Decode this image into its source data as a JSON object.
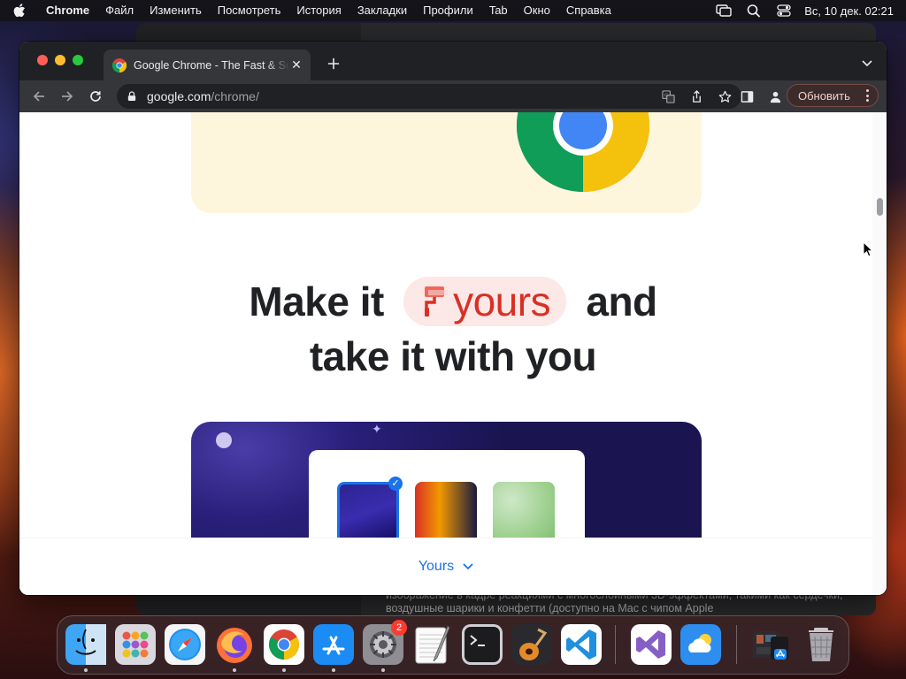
{
  "menubar": {
    "app_name": "Chrome",
    "items": [
      "Файл",
      "Изменить",
      "Посмотреть",
      "История",
      "Закладки",
      "Профили",
      "Tab",
      "Окно",
      "Справка"
    ],
    "clock": "Вс, 10 дек.  02:21"
  },
  "background_window": {
    "text": "изображение в кадре реакциями с многослойными 3D-эффектами, такими как сердечки, воздушные шарики и конфетти (доступно на Mac с чипом Apple"
  },
  "browser": {
    "tab_title": "Google Chrome - The Fast & Secure",
    "url_host": "google.com",
    "url_path": "/chrome/",
    "update_button": "Обновить"
  },
  "page": {
    "headline_before": "Make it",
    "headline_pill": "yours",
    "headline_after": "and",
    "headline_line2": "take it with you",
    "bottom_nav_label": "Yours"
  },
  "dock": {
    "items": [
      {
        "name": "finder-icon",
        "running": true
      },
      {
        "name": "launchpad-icon",
        "running": false
      },
      {
        "name": "safari-icon",
        "running": false
      },
      {
        "name": "firefox-icon",
        "running": true
      },
      {
        "name": "chrome-icon",
        "running": true
      },
      {
        "name": "app-store-icon",
        "running": true
      },
      {
        "name": "system-settings-icon",
        "running": true,
        "badge": "2"
      },
      {
        "name": "textedit-icon",
        "running": false
      },
      {
        "name": "terminal-icon",
        "running": false
      },
      {
        "name": "garageband-icon",
        "running": false
      },
      {
        "name": "vscode-icon",
        "running": false
      },
      {
        "name": "visual-studio-icon",
        "running": false
      },
      {
        "name": "weather-icon",
        "running": false
      },
      {
        "name": "downloads-stack-icon",
        "running": false
      },
      {
        "name": "trash-icon",
        "running": false
      }
    ],
    "settings_badge": "2"
  },
  "colors": {
    "accent": "#1a73e8",
    "pill_bg": "#fce8e6",
    "pill_text": "#d93025",
    "hero_bg": "#fdf6dc"
  }
}
